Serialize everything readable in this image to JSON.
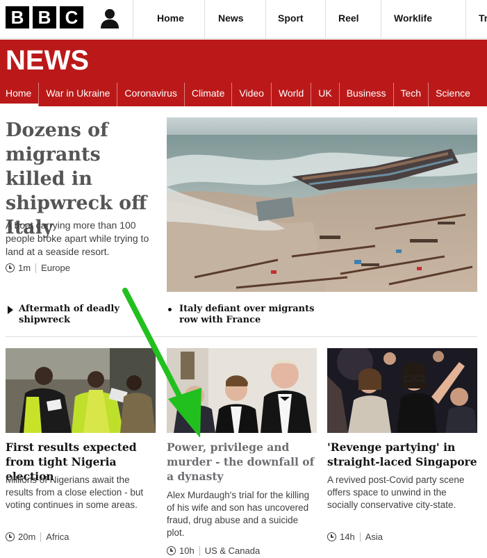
{
  "brand": {
    "letters": [
      "B",
      "B",
      "C"
    ],
    "section_title": "NEWS"
  },
  "top_nav": [
    "Home",
    "News",
    "Sport",
    "Reel",
    "Worklife",
    "Travel"
  ],
  "section_nav": {
    "items": [
      "Home",
      "War in Ukraine",
      "Coronavirus",
      "Climate",
      "Video",
      "World",
      "UK",
      "Business",
      "Tech",
      "Science"
    ],
    "active": "Home"
  },
  "lead": {
    "title": "Dozens of migrants killed in shipwreck off Italy",
    "summary": "A boat carrying more than 100 people broke apart while trying to land at a seaside resort.",
    "time": "1m",
    "region": "Europe",
    "image_icon": "shipwreck-beach-photo"
  },
  "related": [
    {
      "label": "Aftermath of deadly shipwreck",
      "icon": "play-icon"
    },
    {
      "label": "Italy defiant over migrants row with France",
      "icon": "bullet-icon"
    }
  ],
  "cards": [
    {
      "title": "First results expected from tight Nigeria election",
      "summary": "Millions of Nigerians await the results from a close election - but voting continues in some areas.",
      "time": "20m",
      "region": "Africa",
      "visited": false
    },
    {
      "title": "Power, privilege and murder - the downfall of a dynasty",
      "summary": "Alex Murdaugh's trial for the killing of his wife and son has uncovered fraud, drug abuse and a suicide plot.",
      "time": "10h",
      "region": "US & Canada",
      "visited": true
    },
    {
      "title": "'Revenge partying' in straight-laced Singapore",
      "summary": "A revived post-Covid party scene offers space to unwind in the socially conservative city-state.",
      "time": "14h",
      "region": "Asia",
      "visited": false
    }
  ],
  "colors": {
    "brand_red": "#bb1919",
    "annotation_arrow": "#22c01f",
    "visited_title": "#6e6e73"
  }
}
